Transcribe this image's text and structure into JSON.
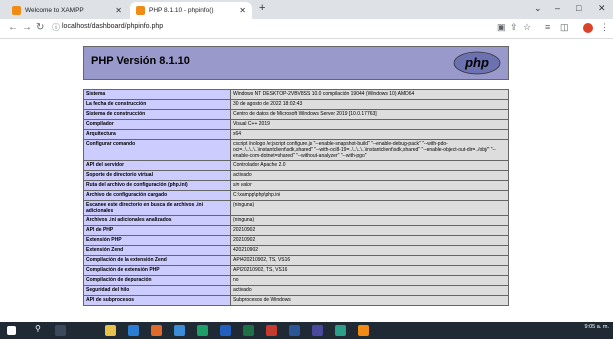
{
  "browser": {
    "tabs": [
      {
        "title": "Welcome to XAMPP",
        "active": false
      },
      {
        "title": "PHP 8.1.10 - phpinfo()",
        "active": true
      }
    ],
    "new_tab_label": "+",
    "url": "localhost/dashboard/phpinfo.php",
    "window_controls": {
      "minimize": "–",
      "maximize": "□",
      "close": "✕"
    },
    "dropdown": "⌄"
  },
  "page": {
    "title": "PHP Versión 8.1.10",
    "logo_text": "php",
    "rows": [
      {
        "label": "Sistema",
        "value": "Windows NT DESKTOP-2VBV8SS 10.0 compilación 19044 (Windows 10) AMD64"
      },
      {
        "label": "La fecha de construcción",
        "value": "30 de agosto de 2022 18:02:43"
      },
      {
        "label": "Sistema de construcción",
        "value": "Centro de datos de Microsoft Windows Server 2019 [10.0.17763]"
      },
      {
        "label": "Compilador",
        "value": "Visual C++ 2019"
      },
      {
        "label": "Arquitectura",
        "value": "x64"
      },
      {
        "label": "Configurar comando",
        "value": "cscript /nologo /e:jscript configure.js \"--enable-snapshot-build\" \"--enable-debug-pack\" \"--with-pdo-oci=..\\..\\..\\..\\instantclient\\sdk,shared\" \"--with-oci8-19=..\\..\\..\\..\\instantclient\\sdk,shared\" \"--enable-object-out-dir=../obj/\" \"--enable-com-dotnet=shared\" \"--without-analyzer\" \"--with-pgo\""
      },
      {
        "label": "API del servidor",
        "value": "Controlador Apache 2.0"
      },
      {
        "label": "Soporte de directorio virtual",
        "value": "activado"
      },
      {
        "label": "Ruta del archivo de configuración (php.ini)",
        "value": "sin valor",
        "muted": true
      },
      {
        "label": "Archivo de configuración cargado",
        "value": "C:\\xampp\\php\\php.ini"
      },
      {
        "label": "Escanee este directorio en busca de archivos .ini adicionales",
        "value": "(ninguna)"
      },
      {
        "label": "Archivos .ini adicionales analizados",
        "value": "(ninguna)"
      },
      {
        "label": "API de PHP",
        "value": "20210902"
      },
      {
        "label": "Extensión PHP",
        "value": "20210902"
      },
      {
        "label": "Extensión Zend",
        "value": "420210902"
      },
      {
        "label": "Compilación de la extensión Zend",
        "value": "API420210902, TS, VS16"
      },
      {
        "label": "Compilación de extensión PHP",
        "value": "API20210902, TS, VS16"
      },
      {
        "label": "Compilación de depuración",
        "value": "no"
      },
      {
        "label": "Seguridad del hilo",
        "value": "activado"
      },
      {
        "label": "API de subprocesos",
        "value": "Subprocesos de Windows"
      }
    ]
  },
  "taskbar": {
    "time": "9:05 a. m."
  },
  "colors": {
    "header_bg": "#9999cc",
    "label_bg": "#ccccff",
    "value_bg": "#dddddd",
    "taskbar_bg": "#1f2a35"
  }
}
